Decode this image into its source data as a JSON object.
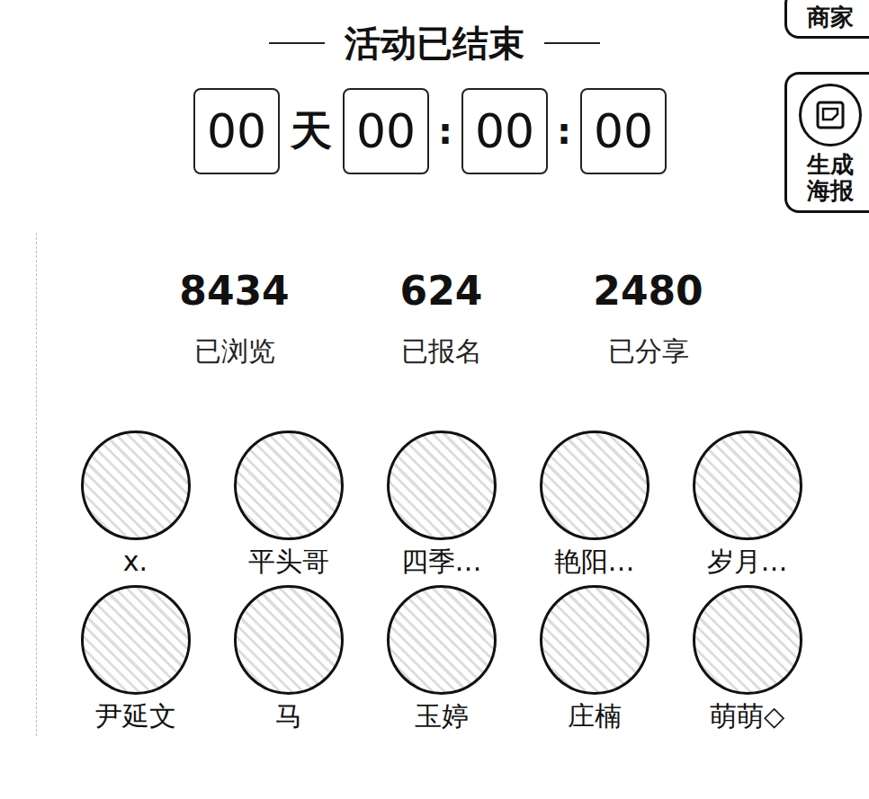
{
  "side_buttons": [
    {
      "label": "商家"
    },
    {
      "label": "生成海报"
    }
  ],
  "title": "活动已结束",
  "countdown": {
    "days": "00",
    "day_unit": "天",
    "hours": "00",
    "minutes": "00",
    "seconds": "00",
    "separators": [
      ":",
      ":"
    ]
  },
  "stats": [
    {
      "value": "8434",
      "label": "已浏览"
    },
    {
      "value": "624",
      "label": "已报名"
    },
    {
      "value": "2480",
      "label": "已分享"
    }
  ],
  "participants": [
    {
      "name": "x."
    },
    {
      "name": "平头哥"
    },
    {
      "name": "四季…"
    },
    {
      "name": "艳阳…"
    },
    {
      "name": "岁月…"
    },
    {
      "name": "尹延文"
    },
    {
      "name": "马"
    },
    {
      "name": "玉婷"
    },
    {
      "name": "庄楠"
    },
    {
      "name": "萌萌◇"
    }
  ]
}
